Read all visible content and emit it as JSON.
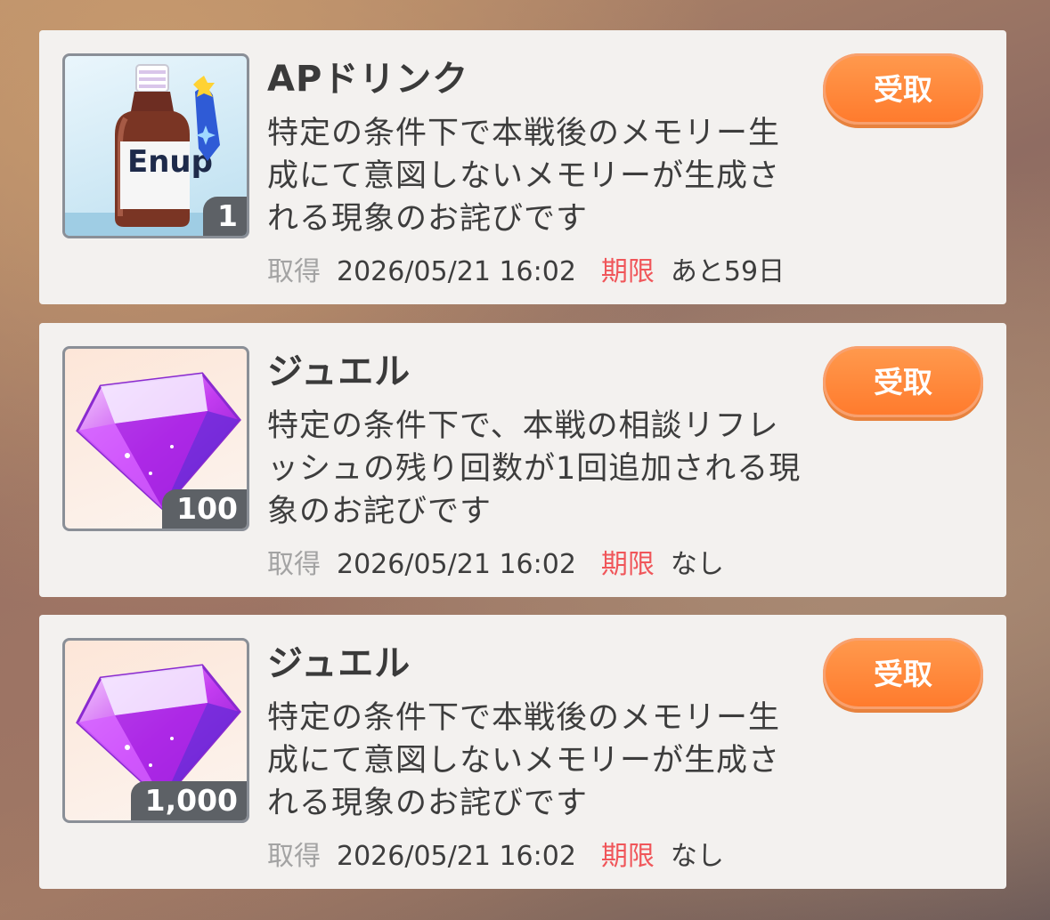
{
  "items": [
    {
      "icon": "ap-drink-icon",
      "quantity": "1",
      "title": "APドリンク",
      "description": "特定の条件下で本戦後のメモリー生成にて意図しないメモリーが生成される現象のお詫びです",
      "acquired_label": "取得",
      "acquired_date": "2026/05/21 16:02",
      "limit_label": "期限",
      "limit_value": "あと59日",
      "claim_label": "受取",
      "icon_text": "Enup"
    },
    {
      "icon": "jewel-icon",
      "quantity": "100",
      "title": "ジュエル",
      "description": "特定の条件下で、本戦の相談リフレッシュの残り回数が1回追加される現象のお詫びです",
      "acquired_label": "取得",
      "acquired_date": "2026/05/21 16:02",
      "limit_label": "期限",
      "limit_value": "なし",
      "claim_label": "受取"
    },
    {
      "icon": "jewel-icon",
      "quantity": "1,000",
      "title": "ジュエル",
      "description": "特定の条件下で本戦後のメモリー生成にて意図しないメモリーが生成される現象のお詫びです",
      "acquired_label": "取得",
      "acquired_date": "2026/05/21 16:02",
      "limit_label": "期限",
      "limit_value": "なし",
      "claim_label": "受取"
    }
  ],
  "colors": {
    "claim_button": "#ff8a3c",
    "limit_label": "#f0565a",
    "acquired_label": "#a3a3a3",
    "card_bg": "#f3f1ef",
    "qty_badge": "#5d6166"
  }
}
